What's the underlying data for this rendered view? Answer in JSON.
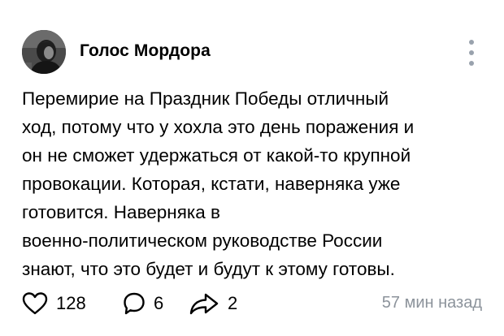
{
  "post": {
    "author": "Голос Мордора",
    "text_lines": [
      "Перемирие на Праздник Победы отличный",
      "ход, потому что у хохла это день поражения и",
      "он не сможет удержаться от какой-то крупной",
      "провокации. Которая, кстати, наверняка уже",
      "готовится. Наверняка в",
      "военно-политическом руководстве России",
      "знают, что это будет и будут к этому готовы."
    ]
  },
  "footer": {
    "likes": "128",
    "comments": "6",
    "shares": "2",
    "time": "57 мин назад"
  },
  "icons": {
    "avatar": "avatar-photo",
    "more": "more-vertical-icon",
    "like": "heart-icon",
    "comment": "comment-icon",
    "share": "share-icon"
  },
  "colors": {
    "text": "#000000",
    "muted": "#8c939b",
    "icon": "#000000",
    "dots": "#99a2ad"
  }
}
